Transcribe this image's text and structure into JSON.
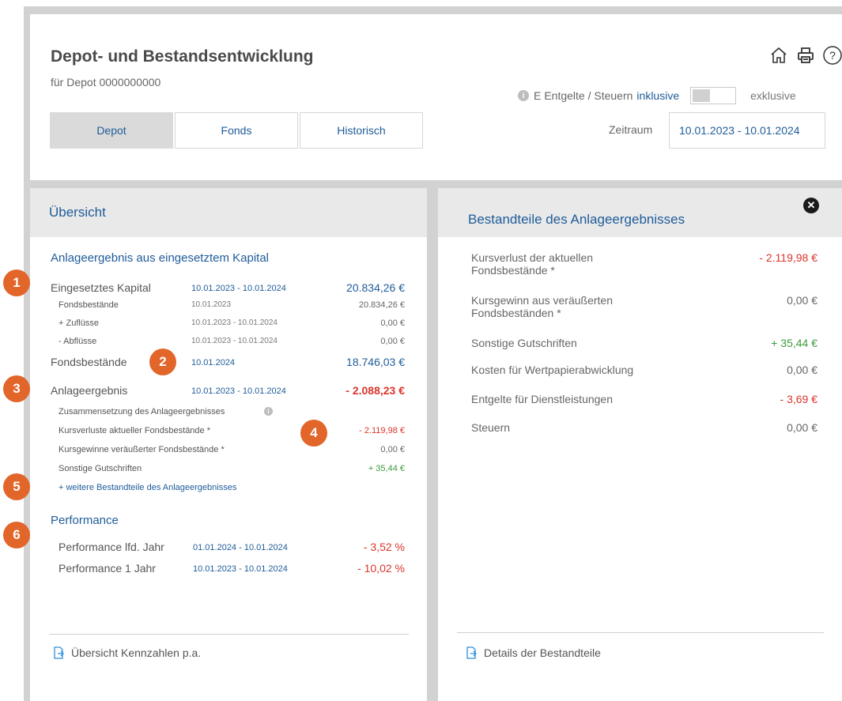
{
  "header": {
    "title": "Depot- und Bestandsentwicklung",
    "subtitle": "für Depot 0000000000",
    "tabs": [
      {
        "label": "Depot",
        "active": true
      },
      {
        "label": "Fonds",
        "active": false
      },
      {
        "label": "Historisch",
        "active": false
      }
    ],
    "toggle": {
      "label": "Entgelte / Steuern",
      "prefix": "E",
      "on_label": "inklusive",
      "off_label": "exklusive"
    },
    "zeitraum_label": "Zeitraum",
    "zeitraum_value": "10.01.2023 - 10.01.2024",
    "icons": [
      "home-icon",
      "print-icon",
      "help-icon"
    ]
  },
  "left": {
    "panel_title": "Übersicht",
    "section1_title": "Anlageergebnis aus eingesetztem Kapital",
    "eingesetztes": {
      "label": "Eingesetztes Kapital",
      "date": "10.01.2023 - 10.01.2024",
      "value": "20.834,26 €"
    },
    "sub_rows": [
      {
        "label": "Fondsbestände",
        "date": "10.01.2023",
        "value": "20.834,26 €"
      },
      {
        "label": "+ Zuflüsse",
        "date": "10.01.2023 - 10.01.2024",
        "value": "0,00 €"
      },
      {
        "label": "- Abflüsse",
        "date": "10.01.2023 - 10.01.2024",
        "value": "0,00 €"
      }
    ],
    "fondsbestaende": {
      "label": "Fondsbestände",
      "date": "10.01.2024",
      "value": "18.746,03 €"
    },
    "anlageergebnis": {
      "label": "Anlageergebnis",
      "date": "10.01.2023 - 10.01.2024",
      "value": "- 2.088,23 €"
    },
    "composition_label": "Zusammensetzung des Anlageergebnisses",
    "composition": [
      {
        "label": "Kursverluste aktueller Fondsbestände *",
        "value": "- 2.119,98 €"
      },
      {
        "label": "Kursgewinne veräußerter Fondsbestände *",
        "value": "0,00 €"
      },
      {
        "label": "Sonstige Gutschriften",
        "value": "+ 35,44 €"
      }
    ],
    "more_link": "+ weitere Bestandteile des Anlageergebnisses",
    "performance_title": "Performance",
    "performance": [
      {
        "label": "Performance lfd. Jahr",
        "date": "01.01.2024 - 10.01.2024",
        "value": "- 3,52 %"
      },
      {
        "label": "Performance 1 Jahr",
        "date": "10.01.2023 - 10.01.2024",
        "value": "- 10,02 %"
      }
    ],
    "footer_link": "Übersicht Kennzahlen p.a."
  },
  "right": {
    "panel_title": "Bestandteile des Anlageergebnisses",
    "rows": [
      {
        "label": "Kursverlust der aktuellen Fondsbestände *",
        "value": "- 2.119,98 €"
      },
      {
        "label": "Kursgewinn aus veräußerten Fondsbeständen *",
        "value": "0,00 €"
      },
      {
        "label": "Sonstige Gutschriften",
        "value": "+ 35,44 €"
      },
      {
        "label": "Kosten für Wertpapierabwicklung",
        "value": "0,00 €"
      },
      {
        "label": "Entgelte für Dienstleistungen",
        "value": "- 3,69 €"
      },
      {
        "label": "Steuern",
        "value": "0,00 €"
      }
    ],
    "footer_link": "Details der Bestandteile"
  },
  "badges": [
    "1",
    "2",
    "3",
    "4",
    "5",
    "6"
  ],
  "colors": {
    "accent": "#1f5c99",
    "negative": "#d9352b",
    "positive": "#3c9a3c",
    "badge": "#e2652a"
  }
}
